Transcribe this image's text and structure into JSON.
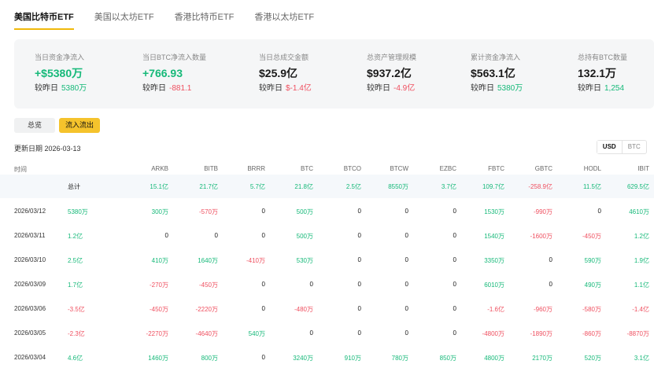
{
  "tabs": [
    "美国比特币ETF",
    "美国以太坊ETF",
    "香港比特币ETF",
    "香港以太坊ETF"
  ],
  "summary": [
    {
      "label": "当日资金净流入",
      "value": "+$5380万",
      "value_class": "pos",
      "sub_label": "较昨日",
      "sub_value": "5380万",
      "sub_class": "pos"
    },
    {
      "label": "当日BTC净流入数量",
      "value": "+766.93",
      "value_class": "pos",
      "sub_label": "较昨日",
      "sub_value": "-881.1",
      "sub_class": "neg"
    },
    {
      "label": "当日总成交金额",
      "value": "$25.9亿",
      "value_class": "",
      "sub_label": "较昨日",
      "sub_value": "$-1.4亿",
      "sub_class": "neg"
    },
    {
      "label": "总资产管理规模",
      "value": "$937.2亿",
      "value_class": "",
      "sub_label": "较昨日",
      "sub_value": "-4.9亿",
      "sub_class": "neg"
    },
    {
      "label": "累计资金净流入",
      "value": "$563.1亿",
      "value_class": "",
      "sub_label": "较昨日",
      "sub_value": "5380万",
      "sub_class": "pos"
    },
    {
      "label": "总持有BTC数量",
      "value": "132.1万",
      "value_class": "",
      "sub_label": "较昨日",
      "sub_value": "1,254",
      "sub_class": "pos"
    }
  ],
  "buttons": {
    "overview": "总览",
    "flow": "流入流出"
  },
  "update_date": "更新日期 2026-03-13",
  "currency": {
    "usd": "USD",
    "btc": "BTC"
  },
  "colors": {
    "positive": "#16b979",
    "negative": "#ef4f5f",
    "accent": "#f5c32c"
  },
  "table": {
    "time_header": "时间",
    "headers": [
      "ARKB",
      "BITB",
      "BRRR",
      "BTC",
      "BTCO",
      "BTCW",
      "EZBC",
      "FBTC",
      "GBTC",
      "HODL",
      "IBIT"
    ],
    "total": {
      "label": "总计",
      "cells": [
        "15.1亿",
        "21.7亿",
        "5.7亿",
        "21.8亿",
        "2.5亿",
        "8550万",
        "3.7亿",
        "109.7亿",
        "-258.9亿",
        "11.5亿",
        "629.5亿"
      ]
    },
    "rows": [
      {
        "date": "2026/03/12",
        "net": "5380万",
        "cells": [
          "300万",
          "-570万",
          "0",
          "500万",
          "0",
          "0",
          "0",
          "1530万",
          "-990万",
          "0",
          "4610万"
        ]
      },
      {
        "date": "2026/03/11",
        "net": "1.2亿",
        "cells": [
          "0",
          "0",
          "0",
          "500万",
          "0",
          "0",
          "0",
          "1540万",
          "-1600万",
          "-450万",
          "1.2亿"
        ]
      },
      {
        "date": "2026/03/10",
        "net": "2.5亿",
        "cells": [
          "410万",
          "1640万",
          "-410万",
          "530万",
          "0",
          "0",
          "0",
          "3350万",
          "0",
          "590万",
          "1.9亿"
        ]
      },
      {
        "date": "2026/03/09",
        "net": "1.7亿",
        "cells": [
          "-270万",
          "-450万",
          "0",
          "0",
          "0",
          "0",
          "0",
          "6010万",
          "0",
          "490万",
          "1.1亿"
        ]
      },
      {
        "date": "2026/03/06",
        "net": "-3.5亿",
        "cells": [
          "-450万",
          "-2220万",
          "0",
          "-480万",
          "0",
          "0",
          "0",
          "-1.6亿",
          "-960万",
          "-580万",
          "-1.4亿"
        ]
      },
      {
        "date": "2026/03/05",
        "net": "-2.3亿",
        "cells": [
          "-2270万",
          "-4640万",
          "540万",
          "0",
          "0",
          "0",
          "0",
          "-4800万",
          "-1890万",
          "-860万",
          "-8870万"
        ]
      },
      {
        "date": "2026/03/04",
        "net": "4.6亿",
        "cells": [
          "1460万",
          "800万",
          "0",
          "3240万",
          "910万",
          "780万",
          "850万",
          "4800万",
          "2170万",
          "520万",
          "3.1亿"
        ]
      }
    ]
  }
}
